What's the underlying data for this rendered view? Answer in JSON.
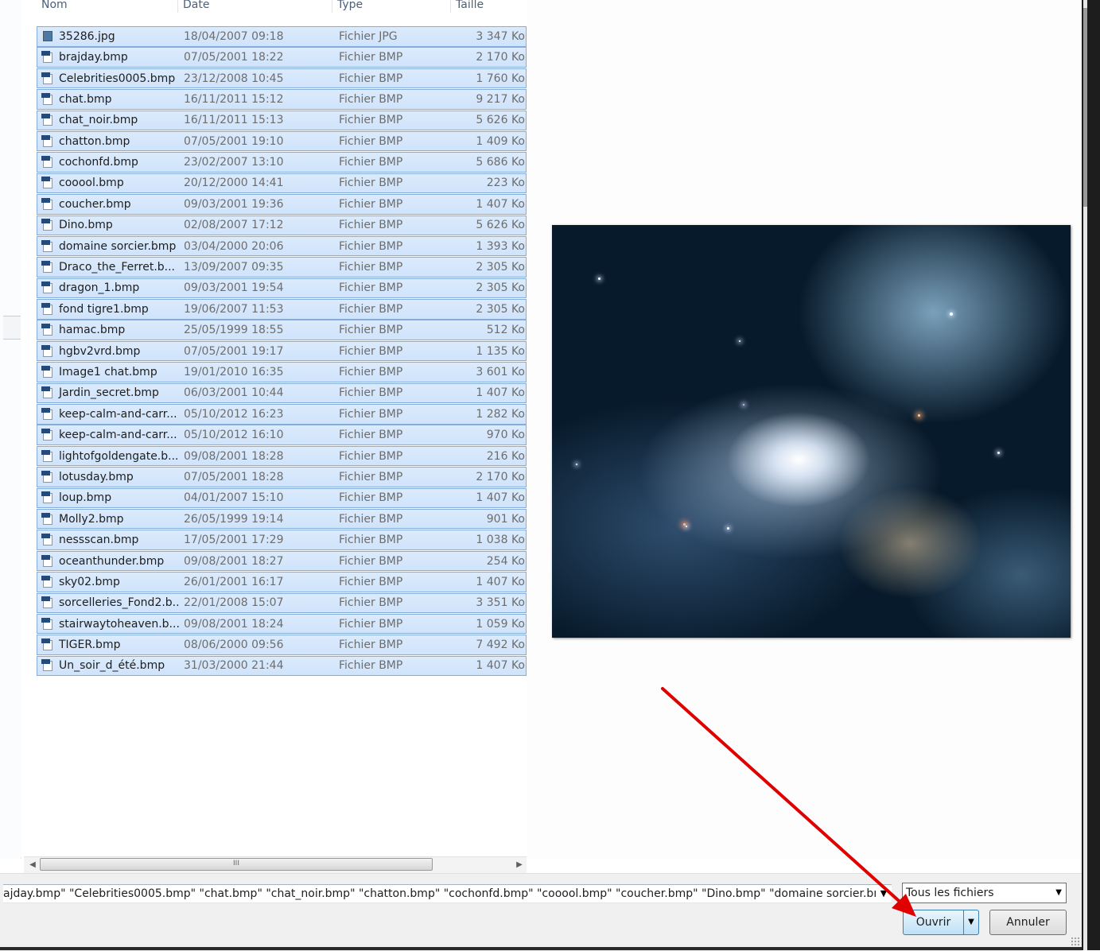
{
  "columns": [
    "Nom",
    "Date",
    "Type",
    "Taille"
  ],
  "files": [
    {
      "name": "35286.jpg",
      "date": "18/04/2007 09:18",
      "type": "Fichier JPG",
      "size": "3 347 Ko",
      "icon": "jpg-file-icon"
    },
    {
      "name": "brajday.bmp",
      "date": "07/05/2001 18:22",
      "type": "Fichier BMP",
      "size": "2 170 Ko",
      "icon": "bmp-file-icon"
    },
    {
      "name": "Celebrities0005.bmp",
      "date": "23/12/2008 10:45",
      "type": "Fichier BMP",
      "size": "1 760 Ko",
      "icon": "bmp-file-icon"
    },
    {
      "name": "chat.bmp",
      "date": "16/11/2011 15:12",
      "type": "Fichier BMP",
      "size": "9 217 Ko",
      "icon": "bmp-file-icon"
    },
    {
      "name": "chat_noir.bmp",
      "date": "16/11/2011 15:13",
      "type": "Fichier BMP",
      "size": "5 626 Ko",
      "icon": "bmp-file-icon"
    },
    {
      "name": "chatton.bmp",
      "date": "07/05/2001 19:10",
      "type": "Fichier BMP",
      "size": "1 409 Ko",
      "icon": "bmp-file-icon"
    },
    {
      "name": "cochonfd.bmp",
      "date": "23/02/2007 13:10",
      "type": "Fichier BMP",
      "size": "5 686 Ko",
      "icon": "bmp-file-icon"
    },
    {
      "name": "cooool.bmp",
      "date": "20/12/2000 14:41",
      "type": "Fichier BMP",
      "size": "223 Ko",
      "icon": "bmp-file-icon"
    },
    {
      "name": "coucher.bmp",
      "date": "09/03/2001 19:36",
      "type": "Fichier BMP",
      "size": "1 407 Ko",
      "icon": "bmp-file-icon"
    },
    {
      "name": "Dino.bmp",
      "date": "02/08/2007 17:12",
      "type": "Fichier BMP",
      "size": "5 626 Ko",
      "icon": "bmp-file-icon"
    },
    {
      "name": "domaine sorcier.bmp",
      "date": "03/04/2000 20:06",
      "type": "Fichier BMP",
      "size": "1 393 Ko",
      "icon": "bmp-file-icon"
    },
    {
      "name": "Draco_the_Ferret.b...",
      "date": "13/09/2007 09:35",
      "type": "Fichier BMP",
      "size": "2 305 Ko",
      "icon": "bmp-file-icon"
    },
    {
      "name": "dragon_1.bmp",
      "date": "09/03/2001 19:54",
      "type": "Fichier BMP",
      "size": "2 305 Ko",
      "icon": "bmp-file-icon"
    },
    {
      "name": "fond tigre1.bmp",
      "date": "19/06/2007 11:53",
      "type": "Fichier BMP",
      "size": "2 305 Ko",
      "icon": "bmp-file-icon"
    },
    {
      "name": "hamac.bmp",
      "date": "25/05/1999 18:55",
      "type": "Fichier BMP",
      "size": "512 Ko",
      "icon": "bmp-file-icon"
    },
    {
      "name": "hgbv2vrd.bmp",
      "date": "07/05/2001 19:17",
      "type": "Fichier BMP",
      "size": "1 135 Ko",
      "icon": "bmp-file-icon"
    },
    {
      "name": "Image1 chat.bmp",
      "date": "19/01/2010 16:35",
      "type": "Fichier BMP",
      "size": "3 601 Ko",
      "icon": "bmp-file-icon"
    },
    {
      "name": "Jardin_secret.bmp",
      "date": "06/03/2001 10:44",
      "type": "Fichier BMP",
      "size": "1 407 Ko",
      "icon": "bmp-file-icon"
    },
    {
      "name": "keep-calm-and-carr...",
      "date": "05/10/2012 16:23",
      "type": "Fichier BMP",
      "size": "1 282 Ko",
      "icon": "bmp-file-icon"
    },
    {
      "name": "keep-calm-and-carr...",
      "date": "05/10/2012 16:10",
      "type": "Fichier BMP",
      "size": "970 Ko",
      "icon": "bmp-file-icon"
    },
    {
      "name": "lightofgoldengate.b...",
      "date": "09/08/2001 18:28",
      "type": "Fichier BMP",
      "size": "216 Ko",
      "icon": "bmp-file-icon"
    },
    {
      "name": "lotusday.bmp",
      "date": "07/05/2001 18:28",
      "type": "Fichier BMP",
      "size": "2 170 Ko",
      "icon": "bmp-file-icon"
    },
    {
      "name": "loup.bmp",
      "date": "04/01/2007 15:10",
      "type": "Fichier BMP",
      "size": "1 407 Ko",
      "icon": "bmp-file-icon"
    },
    {
      "name": "Molly2.bmp",
      "date": "26/05/1999 19:14",
      "type": "Fichier BMP",
      "size": "901 Ko",
      "icon": "bmp-file-icon"
    },
    {
      "name": "nessscan.bmp",
      "date": "17/05/2001 17:29",
      "type": "Fichier BMP",
      "size": "1 038 Ko",
      "icon": "bmp-file-icon"
    },
    {
      "name": "oceanthunder.bmp",
      "date": "09/08/2001 18:27",
      "type": "Fichier BMP",
      "size": "254 Ko",
      "icon": "bmp-file-icon"
    },
    {
      "name": "sky02.bmp",
      "date": "26/01/2001 16:17",
      "type": "Fichier BMP",
      "size": "1 407 Ko",
      "icon": "bmp-file-icon"
    },
    {
      "name": "sorcelleries_Fond2.b...",
      "date": "22/01/2008 15:07",
      "type": "Fichier BMP",
      "size": "3 351 Ko",
      "icon": "bmp-file-icon"
    },
    {
      "name": "stairwaytoheaven.b...",
      "date": "09/08/2001 18:24",
      "type": "Fichier BMP",
      "size": "1 059 Ko",
      "icon": "bmp-file-icon"
    },
    {
      "name": "TIGER.bmp",
      "date": "08/06/2000 09:56",
      "type": "Fichier BMP",
      "size": "7 492 Ko",
      "icon": "bmp-file-icon"
    },
    {
      "name": "Un_soir_d_été.bmp",
      "date": "31/03/2000 21:44",
      "type": "Fichier BMP",
      "size": "1 407 Ko",
      "icon": "bmp-file-icon"
    }
  ],
  "scrollbar": {
    "grip": "III"
  },
  "filename_value": "ajday.bmp\" \"Celebrities0005.bmp\" \"chat.bmp\" \"chat_noir.bmp\" \"chatton.bmp\" \"cochonfd.bmp\" \"cooool.bmp\" \"coucher.bmp\" \"Dino.bmp\" \"domaine sorcier.bmp\" \"Draco_",
  "filter": {
    "selected": "Tous les fichiers"
  },
  "buttons": {
    "open": "Ouvrir",
    "cancel": "Annuler"
  },
  "colors": {
    "selection": "#cfe3fb",
    "selection_border": "#84acdd",
    "annotation_arrow": "#e00000"
  }
}
